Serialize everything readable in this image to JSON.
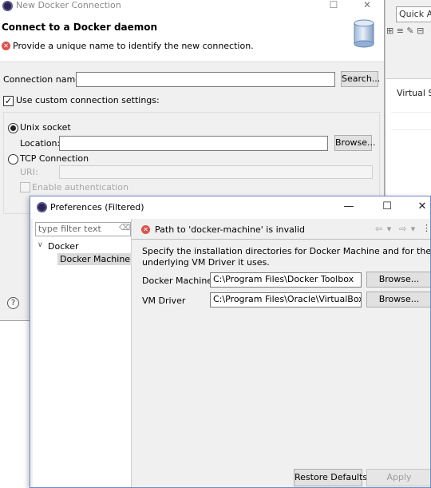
{
  "background_window": {
    "quick_access": "Quick Ac",
    "toolbar_glyphs": "⊞ ≡ ✎ ⊟",
    "virtual_column": "Virtual Si"
  },
  "new_connection_dialog": {
    "title": "New Docker Connection",
    "header_title": "Connect to a Docker daemon",
    "header_message": "Provide a unique name to identify the new connection.",
    "connection_name_label": "Connection name:",
    "connection_name_value": "",
    "search_button": "Search...",
    "use_custom_label": "Use custom connection settings:",
    "use_custom_checked": true,
    "unix_socket_label": "Unix socket",
    "unix_socket_selected": true,
    "location_label": "Location:",
    "location_value": "",
    "browse_button": "Browse...",
    "tcp_label": "TCP Connection",
    "uri_label": "URI:",
    "uri_value": "",
    "enable_auth_label": "Enable authentication",
    "help_glyph": "?"
  },
  "preferences_dialog": {
    "title": "Preferences (Filtered)",
    "filter_placeholder": "type filter text",
    "tree": {
      "parent": "Docker",
      "child": "Docker Machine"
    },
    "error_message": "Path to 'docker-machine' is invalid",
    "description": "Specify the installation directories for Docker Machine and for the underlying VM Driver it uses.",
    "docker_machine_label": "Docker Machine",
    "docker_machine_value": "C:\\Program Files\\Docker Toolbox",
    "vm_driver_label": "VM Driver",
    "vm_driver_value": "C:\\Program Files\\Oracle\\VirtualBox",
    "browse_button_1": "Browse...",
    "browse_button_2": "Browse...",
    "restore_defaults_button": "Restore Defaults",
    "apply_button": "Apply"
  },
  "colors": {
    "error_red": "#d9534f",
    "dialog_bg": "#f0f0f0",
    "selection_gray": "#d9d9d9"
  }
}
